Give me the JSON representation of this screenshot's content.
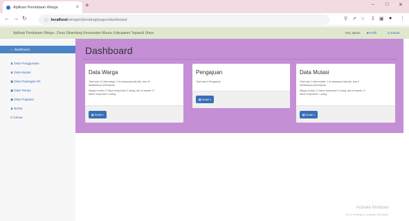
{
  "browser": {
    "tab_title": "Aplikasi Pendataan Warga",
    "tab_close": "×",
    "new_tab": "+",
    "url_host": "localhost",
    "url_path": "/simpp/ciberdang/pages/dashboard",
    "controls": {
      "minimize": "–",
      "maximize": "□",
      "close": "✕"
    }
  },
  "header": {
    "app_title": "Aplikasi Pendataan Warga - Desa Sibandang Kecamatan Muara, Kabupaten Tapanuli Utara",
    "user": "Hai, admin",
    "profile": "Profil",
    "logout": "Keluar"
  },
  "sidebar": {
    "active": "Dashboard",
    "items": [
      {
        "label": "Data Penggunaan",
        "icon": "user-icon"
      },
      {
        "label": "Data Mutasi",
        "icon": "user-icon"
      },
      {
        "label": "Data Pasangan KK",
        "icon": "book-icon"
      },
      {
        "label": "Data Tempo",
        "icon": "book-icon"
      },
      {
        "label": "Data Pegawai",
        "icon": "book-icon"
      },
      {
        "label": "Berita",
        "icon": "user-icon"
      },
      {
        "label": "Keluar",
        "icon": "power-icon"
      }
    ]
  },
  "main": {
    "title": "Dashboard",
    "cards": [
      {
        "title": "Data Warga",
        "lines": [
          "Total ada 13 data warga, 3 di antaranya laki-laki, dan 10",
          "diantaranya perempuan.",
          "Warga di atas 17 tahun berjumlah 3 orang, dan di bawah 17",
          "tahun berjumlah 0 orang."
        ],
        "button": "Detail »"
      },
      {
        "title": "Pengajuan",
        "lines": [
          "Total ada 0 Pengajuan"
        ],
        "button": "Detail »"
      },
      {
        "title": "Data Mutasi",
        "lines": [
          "Total ada 1 data mutasi, 1 di antaranya laki-laki, dan 0",
          "diantaranya perempuan.",
          "Warga di atas 17 tahun berjumlah 0 orang, dan di bawah 17",
          "tahun berjumlah 1 orang."
        ],
        "button": "Detail »"
      }
    ]
  },
  "watermark": {
    "title": "Activate Windows",
    "subtitle": "Go to Settings to activate Windows."
  },
  "colors": {
    "main_bg": "#c58fd6",
    "sidebar_active": "#4a84c4",
    "button": "#3a6fb7",
    "header_bg": "#dfe7cd",
    "tabbar_bg": "#f3dbe2"
  }
}
